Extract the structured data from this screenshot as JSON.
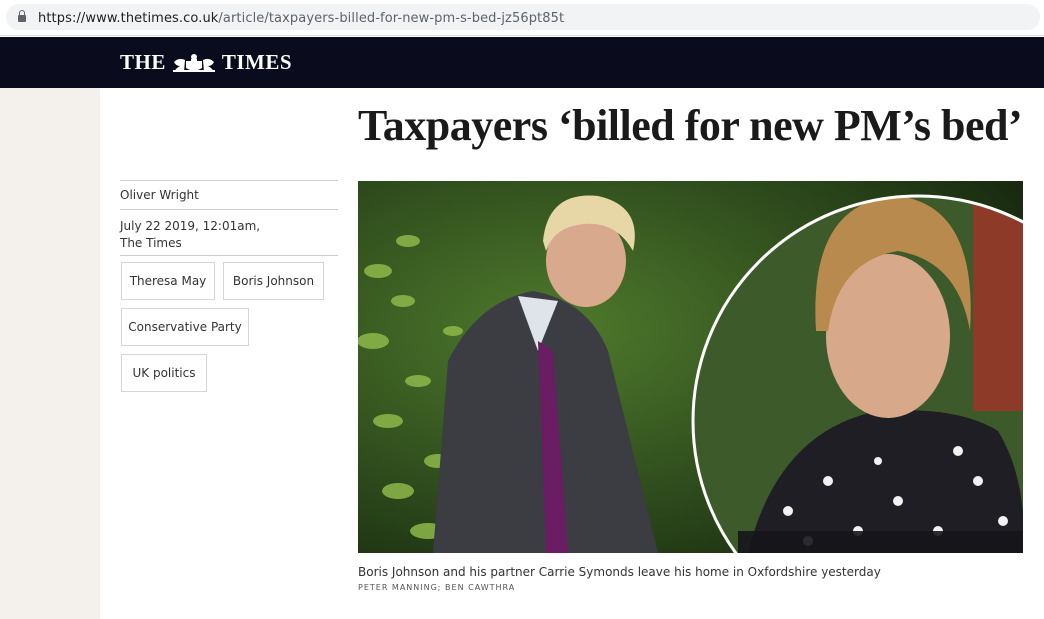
{
  "browser": {
    "url_host": "https://www.thetimes.co.uk",
    "url_path": "/article/taxpayers-billed-for-new-pm-s-bed-jz56pt85t"
  },
  "masthead": {
    "logo_left": "THE",
    "logo_right": "TIMES",
    "crest_icon": "royal-crest-icon"
  },
  "article": {
    "headline": "Taxpayers ‘billed for new PM’s bed’",
    "author": "Oliver Wright",
    "date": "July 22 2019, 12:01am,",
    "publication": "The Times",
    "tags": [
      "Theresa May",
      "Boris Johnson",
      "Conservative Party",
      "UK politics"
    ],
    "image": {
      "caption": "Boris Johnson and his partner Carrie Symonds leave his home in Oxfordshire yesterday",
      "credit": "PETER MANNING; BEN CAWTHRA"
    }
  },
  "colors": {
    "masthead_bg": "#0b0b1e",
    "sidebar_strip": "#f4f0ec",
    "headline_text": "#1a1a1a"
  }
}
